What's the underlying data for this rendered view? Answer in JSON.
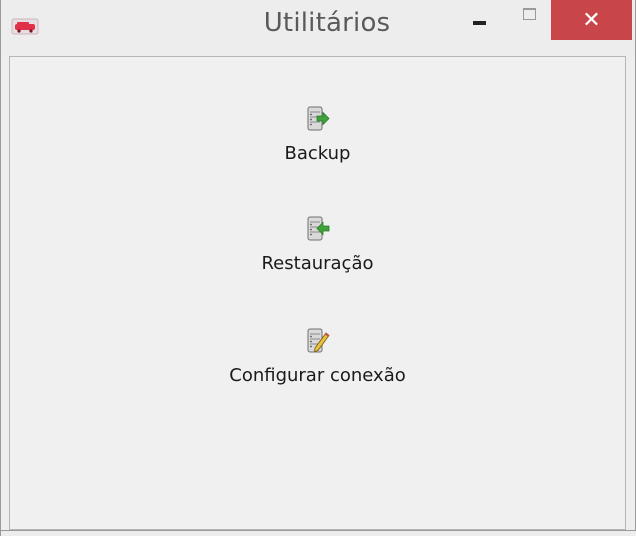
{
  "window": {
    "title": "Utilitários",
    "icon": "app-logo-icon",
    "close_symbol": "✕"
  },
  "items": [
    {
      "label": "Backup",
      "icon": "database-export-icon"
    },
    {
      "label": "Restauração",
      "icon": "database-import-icon"
    },
    {
      "label": "Configurar conexão",
      "icon": "database-edit-icon"
    }
  ],
  "colors": {
    "close_button": "#c8454a",
    "arrow_green": "#3fa33a",
    "title_text": "#5a5a5a"
  }
}
